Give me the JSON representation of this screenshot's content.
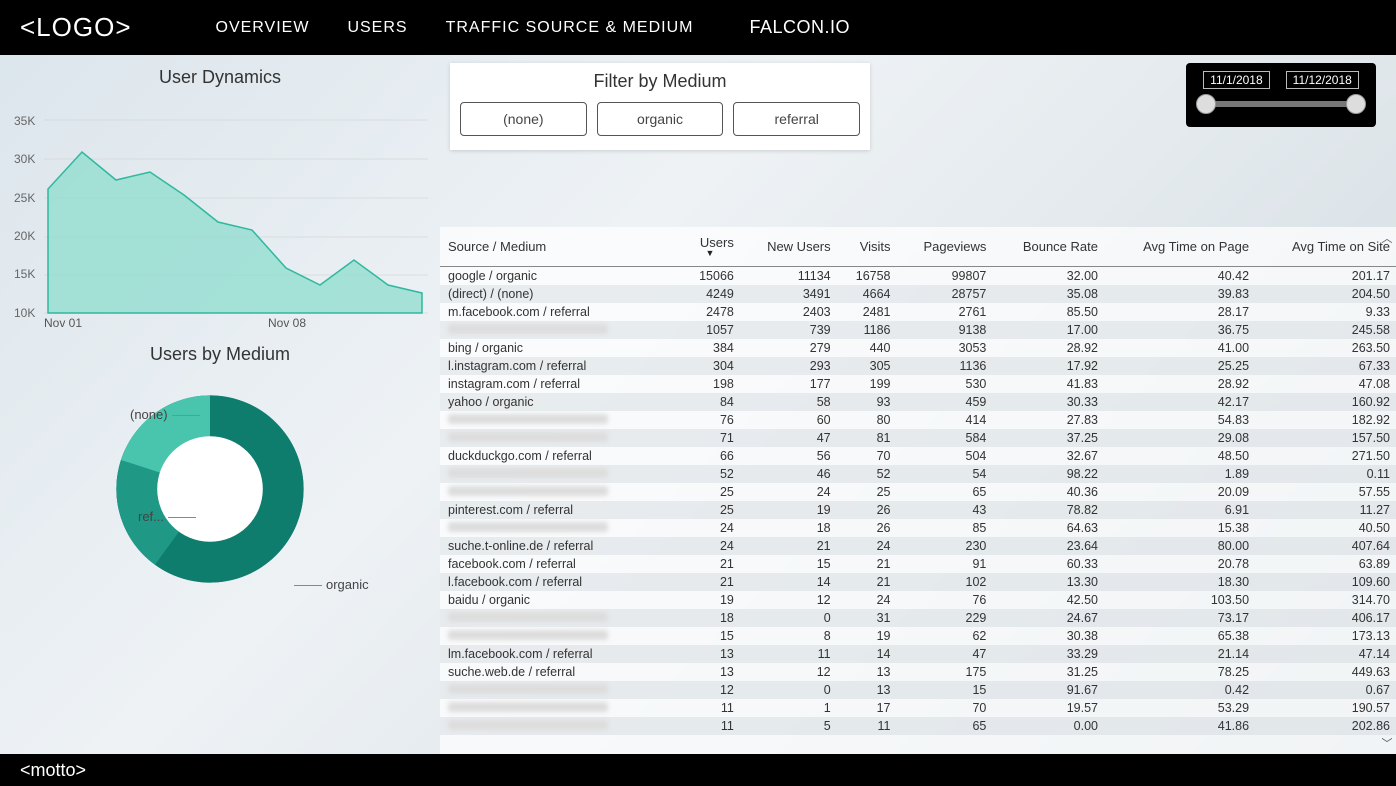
{
  "header": {
    "logo": "<LOGO>",
    "nav": [
      "OVERVIEW",
      "USERS",
      "TRAFFIC SOURCE & MEDIUM"
    ],
    "brand": "FALCON.IO"
  },
  "footer": {
    "motto": "<motto>"
  },
  "filter": {
    "title": "Filter by Medium",
    "options": [
      "(none)",
      "organic",
      "referral"
    ]
  },
  "dateRange": {
    "start": "11/1/2018",
    "end": "11/12/2018"
  },
  "userDynamics": {
    "title": "User Dynamics"
  },
  "usersByMedium": {
    "title": "Users by Medium",
    "segments": [
      "(none)",
      "ref...",
      "organic"
    ]
  },
  "table": {
    "columns": [
      "Source / Medium",
      "Users",
      "New Users",
      "Visits",
      "Pageviews",
      "Bounce Rate",
      "Avg Time on Page",
      "Avg Time on Site"
    ],
    "rows": [
      {
        "src": "google / organic",
        "u": "15066",
        "nu": "11134",
        "v": "16758",
        "pv": "99807",
        "br": "32.00",
        "atp": "40.42",
        "ats": "201.17"
      },
      {
        "src": "(direct) / (none)",
        "u": "4249",
        "nu": "3491",
        "v": "4664",
        "pv": "28757",
        "br": "35.08",
        "atp": "39.83",
        "ats": "204.50"
      },
      {
        "src": "m.facebook.com / referral",
        "u": "2478",
        "nu": "2403",
        "v": "2481",
        "pv": "2761",
        "br": "85.50",
        "atp": "28.17",
        "ats": "9.33"
      },
      {
        "src": "",
        "u": "1057",
        "nu": "739",
        "v": "1186",
        "pv": "9138",
        "br": "17.00",
        "atp": "36.75",
        "ats": "245.58"
      },
      {
        "src": "bing / organic",
        "u": "384",
        "nu": "279",
        "v": "440",
        "pv": "3053",
        "br": "28.92",
        "atp": "41.00",
        "ats": "263.50"
      },
      {
        "src": "l.instagram.com / referral",
        "u": "304",
        "nu": "293",
        "v": "305",
        "pv": "1136",
        "br": "17.92",
        "atp": "25.25",
        "ats": "67.33"
      },
      {
        "src": "instagram.com / referral",
        "u": "198",
        "nu": "177",
        "v": "199",
        "pv": "530",
        "br": "41.83",
        "atp": "28.92",
        "ats": "47.08"
      },
      {
        "src": "yahoo / organic",
        "u": "84",
        "nu": "58",
        "v": "93",
        "pv": "459",
        "br": "30.33",
        "atp": "42.17",
        "ats": "160.92"
      },
      {
        "src": "",
        "u": "76",
        "nu": "60",
        "v": "80",
        "pv": "414",
        "br": "27.83",
        "atp": "54.83",
        "ats": "182.92"
      },
      {
        "src": "",
        "u": "71",
        "nu": "47",
        "v": "81",
        "pv": "584",
        "br": "37.25",
        "atp": "29.08",
        "ats": "157.50"
      },
      {
        "src": "duckduckgo.com / referral",
        "u": "66",
        "nu": "56",
        "v": "70",
        "pv": "504",
        "br": "32.67",
        "atp": "48.50",
        "ats": "271.50"
      },
      {
        "src": "",
        "u": "52",
        "nu": "46",
        "v": "52",
        "pv": "54",
        "br": "98.22",
        "atp": "1.89",
        "ats": "0.11"
      },
      {
        "src": "",
        "u": "25",
        "nu": "24",
        "v": "25",
        "pv": "65",
        "br": "40.36",
        "atp": "20.09",
        "ats": "57.55"
      },
      {
        "src": "pinterest.com / referral",
        "u": "25",
        "nu": "19",
        "v": "26",
        "pv": "43",
        "br": "78.82",
        "atp": "6.91",
        "ats": "11.27"
      },
      {
        "src": "",
        "u": "24",
        "nu": "18",
        "v": "26",
        "pv": "85",
        "br": "64.63",
        "atp": "15.38",
        "ats": "40.50"
      },
      {
        "src": "suche.t-online.de / referral",
        "u": "24",
        "nu": "21",
        "v": "24",
        "pv": "230",
        "br": "23.64",
        "atp": "80.00",
        "ats": "407.64"
      },
      {
        "src": "facebook.com / referral",
        "u": "21",
        "nu": "15",
        "v": "21",
        "pv": "91",
        "br": "60.33",
        "atp": "20.78",
        "ats": "63.89"
      },
      {
        "src": "l.facebook.com / referral",
        "u": "21",
        "nu": "14",
        "v": "21",
        "pv": "102",
        "br": "13.30",
        "atp": "18.30",
        "ats": "109.60"
      },
      {
        "src": "baidu / organic",
        "u": "19",
        "nu": "12",
        "v": "24",
        "pv": "76",
        "br": "42.50",
        "atp": "103.50",
        "ats": "314.70"
      },
      {
        "src": "",
        "u": "18",
        "nu": "0",
        "v": "31",
        "pv": "229",
        "br": "24.67",
        "atp": "73.17",
        "ats": "406.17"
      },
      {
        "src": "",
        "u": "15",
        "nu": "8",
        "v": "19",
        "pv": "62",
        "br": "30.38",
        "atp": "65.38",
        "ats": "173.13"
      },
      {
        "src": "lm.facebook.com / referral",
        "u": "13",
        "nu": "11",
        "v": "14",
        "pv": "47",
        "br": "33.29",
        "atp": "21.14",
        "ats": "47.14"
      },
      {
        "src": "suche.web.de / referral",
        "u": "13",
        "nu": "12",
        "v": "13",
        "pv": "175",
        "br": "31.25",
        "atp": "78.25",
        "ats": "449.63"
      },
      {
        "src": "",
        "u": "12",
        "nu": "0",
        "v": "13",
        "pv": "15",
        "br": "91.67",
        "atp": "0.42",
        "ats": "0.67"
      },
      {
        "src": "",
        "u": "11",
        "nu": "1",
        "v": "17",
        "pv": "70",
        "br": "19.57",
        "atp": "53.29",
        "ats": "190.57"
      },
      {
        "src": "",
        "u": "11",
        "nu": "5",
        "v": "11",
        "pv": "65",
        "br": "0.00",
        "atp": "41.86",
        "ats": "202.86"
      }
    ]
  },
  "chart_data": [
    {
      "type": "area",
      "title": "User Dynamics",
      "xlabel": "",
      "ylabel": "",
      "ylim": [
        10000,
        35000
      ],
      "y_ticks": [
        "35K",
        "30K",
        "25K",
        "20K",
        "15K",
        "10K"
      ],
      "x_ticks": [
        "Nov 01",
        "Nov 08"
      ],
      "x": [
        "Nov 01",
        "Nov 02",
        "Nov 03",
        "Nov 04",
        "Nov 05",
        "Nov 06",
        "Nov 07",
        "Nov 08",
        "Nov 09",
        "Nov 10",
        "Nov 11",
        "Nov 12"
      ],
      "values": [
        26000,
        30000,
        26500,
        27500,
        25000,
        22000,
        21000,
        17000,
        15000,
        18000,
        15000,
        14000
      ],
      "color": "#58c8b5"
    },
    {
      "type": "pie",
      "title": "Users by Medium",
      "series": [
        {
          "name": "organic",
          "value": 65,
          "color": "#0e7d6d"
        },
        {
          "name": "(none)",
          "value": 20,
          "color": "#49c4ad"
        },
        {
          "name": "referral",
          "value": 15,
          "color": "#1f9986"
        }
      ]
    }
  ]
}
